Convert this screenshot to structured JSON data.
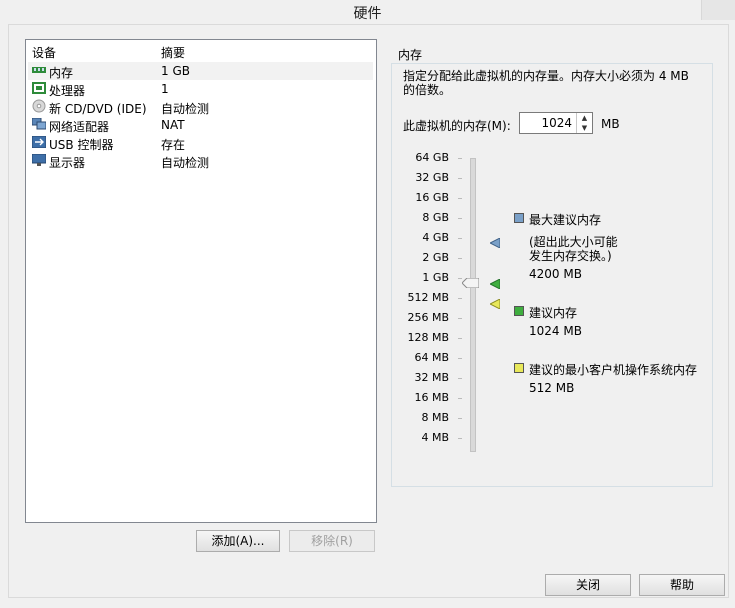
{
  "window": {
    "title": "硬件"
  },
  "device_list": {
    "col_device": "设备",
    "col_summary": "摘要",
    "items": [
      {
        "icon": "memory-icon",
        "name": "内存",
        "summary": "1 GB"
      },
      {
        "icon": "processor-icon",
        "name": "处理器",
        "summary": "1"
      },
      {
        "icon": "cd-dvd-icon",
        "name": "新 CD/DVD (IDE)",
        "summary": "自动检测"
      },
      {
        "icon": "network-adapter-icon",
        "name": "网络适配器",
        "summary": "NAT"
      },
      {
        "icon": "usb-controller-icon",
        "name": "USB 控制器",
        "summary": "存在"
      },
      {
        "icon": "display-icon",
        "name": "显示器",
        "summary": "自动检测"
      }
    ]
  },
  "buttons": {
    "add": "添加(A)...",
    "remove": "移除(R)",
    "close": "关闭",
    "help": "帮助"
  },
  "memory": {
    "group_title": "内存",
    "description": "指定分配给此虚拟机的内存量。内存大小必须为 4 MB 的倍数。",
    "field_label": "此虚拟机的内存(M):",
    "value": "1024",
    "unit": "MB",
    "scale": [
      "64 GB",
      "32 GB",
      "16 GB",
      "8 GB",
      "4 GB",
      "2 GB",
      "1 GB",
      "512 MB",
      "256 MB",
      "128 MB",
      "64 MB",
      "32 MB",
      "16 MB",
      "8 MB",
      "4 MB"
    ],
    "legend": {
      "max_title": "最大建议内存",
      "max_note1": "(超出此大小可能",
      "max_note2": "发生内存交换。)",
      "max_value": "4200 MB",
      "rec_title": "建议内存",
      "rec_value": "1024 MB",
      "min_title": "建议的最小客户机操作系统内存",
      "min_value": "512 MB"
    },
    "colors": {
      "max": "#7aa0c8",
      "rec": "#3fae3f",
      "min": "#e8e85a"
    }
  }
}
